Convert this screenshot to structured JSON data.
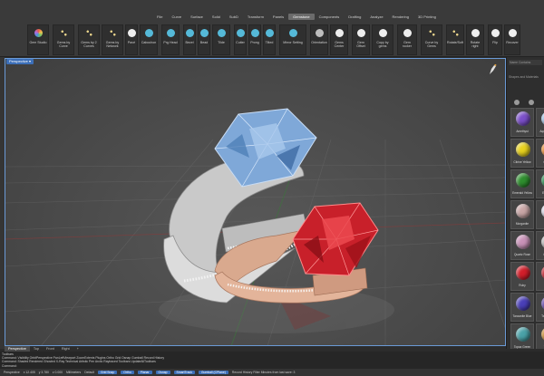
{
  "menu": {
    "items": [
      "File",
      "Curve",
      "Surface",
      "Solid",
      "SubD",
      "Transform",
      "Panels",
      "Gemstone",
      "Components",
      "Drafting",
      "Analyze",
      "Rendering",
      "3D Printing"
    ],
    "active_index": 7
  },
  "ribbon": {
    "buttons": [
      {
        "label": "Gem Studio",
        "icon": "gem-studio-icon",
        "color": "multi"
      },
      {
        "label": "Gems by Curve",
        "icon": "gems-by-curve-icon",
        "color": "dots"
      },
      {
        "label": "Gems by 2 Curves",
        "icon": "gems-by-2-curves-icon",
        "color": "dots"
      },
      {
        "label": "Gems by Network",
        "icon": "gems-by-network-icon",
        "color": "dots"
      },
      {
        "label": "Pavé",
        "icon": "pave-icon",
        "color": "white"
      },
      {
        "label": "Cabochon",
        "icon": "cabochon-icon",
        "color": "cyan"
      },
      {
        "label": "Prg Head",
        "icon": "prong-head-icon",
        "color": "cyan"
      },
      {
        "label": "Bezel",
        "icon": "bezel-icon",
        "color": "cyan"
      },
      {
        "label": "Bead",
        "icon": "bead-icon",
        "color": "cyan"
      },
      {
        "label": "Tilde",
        "icon": "tilde-icon",
        "color": "cyan"
      },
      {
        "label": "Cutter",
        "icon": "cutter-icon",
        "color": "cyan"
      },
      {
        "label": "Prong",
        "icon": "prong-icon",
        "color": "cyan"
      },
      {
        "label": "Tilted",
        "icon": "tilted-icon",
        "color": "cyan"
      },
      {
        "label": "Mirror Setting",
        "icon": "mirror-setting-icon",
        "color": "cyan"
      },
      {
        "label": "Orientation",
        "icon": "orientation-icon",
        "color": "grey"
      },
      {
        "label": "Gems Center",
        "icon": "gems-center-icon",
        "color": "white"
      },
      {
        "label": "Gem Offset",
        "icon": "gem-offset-icon",
        "color": "white"
      },
      {
        "label": "Copy by gems",
        "icon": "copy-by-gems-icon",
        "color": "white"
      },
      {
        "label": "Gem rocker",
        "icon": "gem-rocker-icon",
        "color": "white"
      },
      {
        "label": "Curve by Gems",
        "icon": "curve-by-gems-icon",
        "color": "dots"
      },
      {
        "label": "Rotate/Soft",
        "icon": "rotate-soft-icon",
        "color": "dots"
      },
      {
        "label": "Rotate right",
        "icon": "rotate-right-icon",
        "color": "white"
      },
      {
        "label": "Flip",
        "icon": "flip-icon",
        "color": "white"
      },
      {
        "label": "Recover",
        "icon": "recover-icon",
        "color": "white"
      }
    ]
  },
  "viewport": {
    "label": "Perspective ▾",
    "tabs": [
      "Perspective",
      "Top",
      "Front",
      "Right",
      "+"
    ]
  },
  "right_panel": {
    "field1": "Name Contains",
    "field2": "Shapes and Materials",
    "gems": [
      {
        "name": "Amethyst",
        "color": "#7b4fc9"
      },
      {
        "name": "Aquamarine",
        "color": "#9ec4e8"
      },
      {
        "name": "Citrine Yellow",
        "color": "#e8d21e"
      },
      {
        "name": "Citrine",
        "color": "#e98a2a"
      },
      {
        "name": "Emerald Yellow",
        "color": "#2f8f2f"
      },
      {
        "name": "Emerald",
        "color": "#1f8a4a"
      },
      {
        "name": "Morganite",
        "color": "#c9a6a6"
      },
      {
        "name": "Opal",
        "color": "#d9d9e8"
      },
      {
        "name": "Quartz Rose",
        "color": "#c992b8"
      },
      {
        "name": "Quartz",
        "color": "#b9b9b9"
      },
      {
        "name": "Ruby",
        "color": "#d21e2a"
      },
      {
        "name": "Ruby",
        "color": "#c01824"
      },
      {
        "name": "Tanzanite Blue",
        "color": "#4a3fb8"
      },
      {
        "name": "Tanzanite",
        "color": "#5d3fa8"
      },
      {
        "name": "Topaz Green",
        "color": "#4aa2a8"
      },
      {
        "name": "Topaz",
        "color": "#c98a2a"
      }
    ]
  },
  "command": {
    "lines": [
      "Toolbars",
      "Command: Visibility  OrbitPerspective  PanLeftViewport  ZoomExtents  Plugins  Ortho  Grid  Osnap  Gumball  Record History",
      "Command: Shaded  Rendered  Ghosted  X-Ray  Technical  Artistic  Pen  Arctic  Raytraced  Toolbars  UpdateAllToolbars",
      "Command:"
    ]
  },
  "status": {
    "items": [
      "Perspective",
      "x 12.405",
      "y 3.780",
      "z 0.000",
      "Millimeters",
      "Default"
    ],
    "pills": [
      "Grid Snap",
      "Ortho",
      "Planar",
      "Osnap",
      "SmartTrack",
      "Gumball (CPlane)"
    ],
    "tail": "Record History  Filter  Minutes from last save: 3"
  }
}
